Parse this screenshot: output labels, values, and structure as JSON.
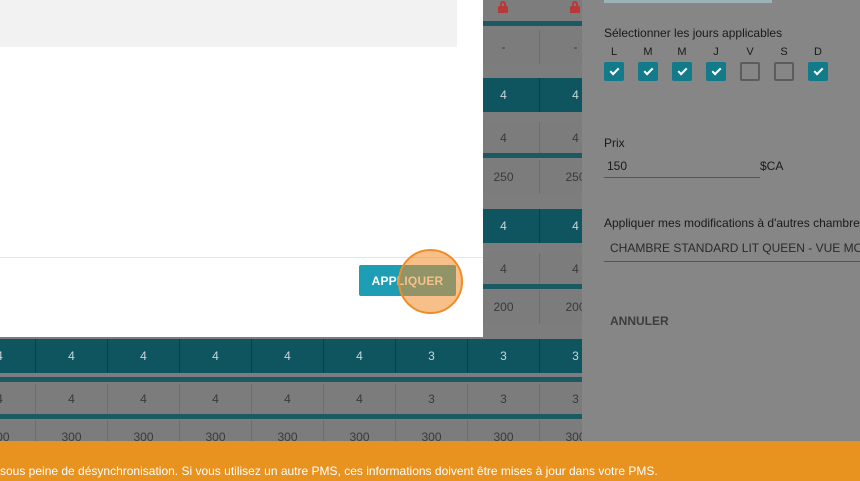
{
  "grid": {
    "top_rows": [
      {
        "values": [
          "-",
          "-"
        ]
      },
      {
        "values": [
          "4",
          "4"
        ]
      },
      {
        "values": [
          "4",
          "4"
        ]
      },
      {
        "values": [
          "250",
          "250"
        ]
      },
      {
        "values": [
          "4",
          "4"
        ]
      },
      {
        "values": [
          "4",
          "4"
        ]
      },
      {
        "values": [
          "200",
          "200"
        ]
      }
    ],
    "bottom_rows": [
      {
        "values": [
          "4",
          "4",
          "4",
          "4",
          "4",
          "4",
          "3",
          "3",
          "3"
        ]
      },
      {
        "values": [
          "4",
          "4",
          "4",
          "4",
          "4",
          "4",
          "3",
          "3",
          "3"
        ]
      },
      {
        "values": [
          "300",
          "300",
          "300",
          "300",
          "300",
          "300",
          "300",
          "300",
          "300"
        ]
      }
    ]
  },
  "modal": {
    "apply_label": "APPLIQUER"
  },
  "panel": {
    "days_label": "Sélectionner les jours applicables",
    "days": [
      {
        "letter": "L",
        "checked": true
      },
      {
        "letter": "M",
        "checked": true
      },
      {
        "letter": "M",
        "checked": true
      },
      {
        "letter": "J",
        "checked": true
      },
      {
        "letter": "V",
        "checked": false
      },
      {
        "letter": "S",
        "checked": false
      },
      {
        "letter": "D",
        "checked": true
      }
    ],
    "price_label": "Prix",
    "price_value": "150",
    "currency": "$CA",
    "apply_other_label": "Appliquer mes modifications à d'autres chambres",
    "room_value": "CHAMBRE STANDARD LIT QUEEN - VUE MONTAGNE",
    "cancel_label": "ANNULER"
  },
  "banner": {
    "text": "sous peine de désynchronisation. Si vous utilisez un autre PMS, ces informations doivent être mises à jour dans votre PMS."
  }
}
